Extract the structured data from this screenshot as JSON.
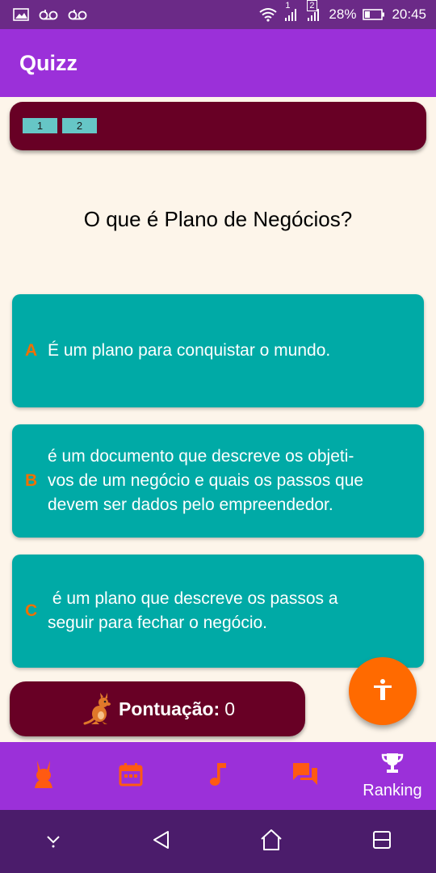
{
  "status_bar": {
    "sim1_label": "1",
    "sim2_label": "2",
    "battery_percent": "28%",
    "time": "20:45",
    "icons": [
      "image-icon",
      "voicemail-icon",
      "voicemail-icon",
      "wifi-icon",
      "signal-icon",
      "signal-icon",
      "battery-icon"
    ]
  },
  "app_bar": {
    "title": "Quizz"
  },
  "question_nav": {
    "items": [
      "1",
      "2"
    ]
  },
  "question": {
    "text": "O que é Plano de Negócios?"
  },
  "answers": [
    {
      "letter": "A",
      "lines": [
        "É um plano para conquistar o mundo."
      ]
    },
    {
      "letter": "B",
      "lines": [
        "é um documento que descreve os objeti-",
        "vos de um negócio e quais os passos que",
        "devem ser dados pelo empreendedor."
      ]
    },
    {
      "letter": "C",
      "lines": [
        " é um plano que descreve os passos a",
        "seguir para fechar o negócio."
      ]
    }
  ],
  "score": {
    "label": "Pontuação:",
    "value": "0",
    "icon": "kangaroo-icon"
  },
  "fab": {
    "icon": "accessibility-icon"
  },
  "bottom_nav": {
    "items": [
      {
        "icon": "rabbit-icon",
        "label": ""
      },
      {
        "icon": "calendar-icon",
        "label": ""
      },
      {
        "icon": "music-note-icon",
        "label": ""
      },
      {
        "icon": "chat-icon",
        "label": ""
      },
      {
        "icon": "trophy-icon",
        "label": "Ranking"
      }
    ]
  },
  "colors": {
    "status_bar": "#6b2a87",
    "app_bar": "#9b30d9",
    "background": "#fdf5ea",
    "dark_red": "#680025",
    "chip": "#66c6c6",
    "answer": "#00aaa6",
    "letter": "#f07000",
    "fab": "#ff6a00",
    "nav_icon": "#ff5a12",
    "sys_nav": "#4b1c6b"
  }
}
